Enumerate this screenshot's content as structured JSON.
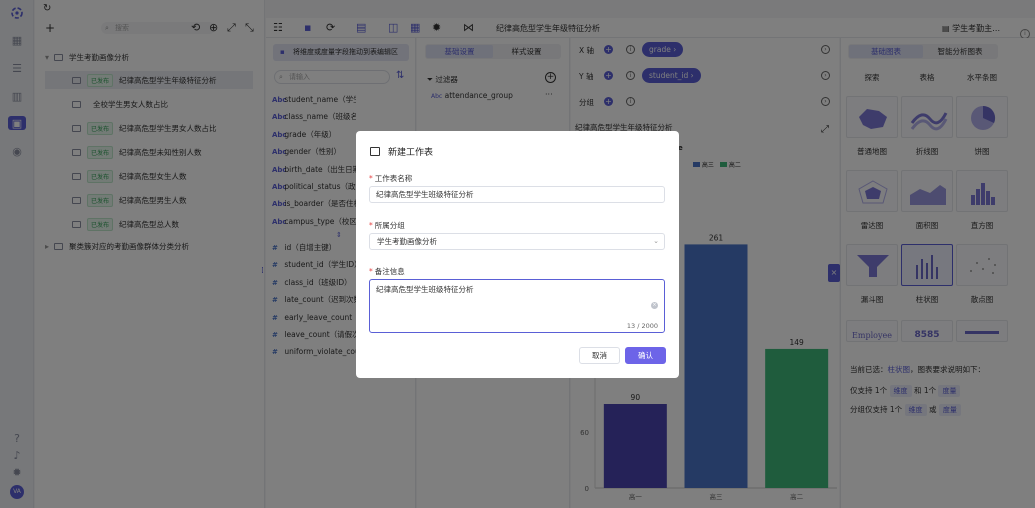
{
  "app": {
    "breadcrumb_title": "纪律高危型学生年级特征分析",
    "right_title": "学生考勤主…",
    "avatar": "VA"
  },
  "tree": {
    "search_placeholder": "搜索",
    "root": "学生考勤画像分析",
    "items": [
      {
        "badge": "已发布",
        "label": "纪律高危型学生年级特征分析",
        "selected": true
      },
      {
        "badge": "",
        "label": "全校学生男女人数占比",
        "selected": false
      },
      {
        "badge": "已发布",
        "label": "纪律高危型学生男女人数占比",
        "selected": false
      },
      {
        "badge": "已发布",
        "label": "纪律高危型未知性别人数",
        "selected": false
      },
      {
        "badge": "已发布",
        "label": "纪律高危型女生人数",
        "selected": false
      },
      {
        "badge": "已发布",
        "label": "纪律高危型男生人数",
        "selected": false
      },
      {
        "badge": "已发布",
        "label": "纪律高危型总人数",
        "selected": false
      }
    ],
    "root2": "聚类簇对应的考勤画像群体分类分析"
  },
  "fields": {
    "hint": "将维度或度量字段拖动到表编辑区",
    "search_placeholder": "请输入",
    "dimensions": [
      "student_name（学生姓名）",
      "class_name（班级名称）",
      "grade（年级）",
      "gender（性别）",
      "birth_date（出生日期）",
      "political_status（政治面貌）",
      "is_boarder（是否住校）",
      "campus_type（校区类型）"
    ],
    "measures": [
      "id（自增主键）",
      "student_id（学生ID）",
      "class_id（班级ID）",
      "late_count（迟到次数）",
      "early_leave_count",
      "leave_count（请假次数）",
      "uniform_violate_count"
    ]
  },
  "settings": {
    "tab_basic": "基础设置",
    "tab_style": "样式设置",
    "filter_label": "过滤器",
    "filter_item": "attendance_group",
    "filter_type": "Abc"
  },
  "chart": {
    "x_label": "X 轴",
    "x_pill": "grade ›",
    "y_label": "Y 轴",
    "y_pill": "student_id ›",
    "group_label": "分组",
    "title": "纪律高危型学生年级特征分析",
    "legend_partial": "e",
    "legend": [
      "高三",
      "高二"
    ]
  },
  "chart_data": {
    "type": "bar",
    "title": "纪律高危型学生年级特征分析",
    "categories": [
      "高一",
      "高三",
      "高二"
    ],
    "values": [
      90,
      261,
      149
    ],
    "colors": [
      "#4b45b0",
      "#4a74c9",
      "#3fb87a"
    ],
    "y_ticks_visible": [
      "60",
      "0"
    ],
    "ylim": [
      0,
      300
    ]
  },
  "gallery": {
    "tab_basic": "基础图表",
    "tab_smart": "智能分析图表",
    "top_labels": [
      "探索",
      "表格",
      "水平条图"
    ],
    "charts": [
      "普通地图",
      "折线图",
      "饼图",
      "雷达图",
      "面积图",
      "直方图",
      "漏斗图",
      "柱状图",
      "散点图"
    ],
    "partial_labels": [
      "Employee",
      "8585"
    ],
    "selected_text_prefix": "当前已选：",
    "selected_chart": "柱状图",
    "selected_text_suffix": "，图表要求说明如下：",
    "rule1_a": "仅支持 1个",
    "rule1_dim": "维度",
    "rule1_b": "和 1个",
    "rule1_mea": "度量",
    "rule2_a": "分组仅支持 1个",
    "rule2_dim": "维度",
    "rule2_b": "或",
    "rule2_mea": "度量"
  },
  "modal": {
    "title": "新建工作表",
    "name_label": "工作表名称",
    "name_value": "纪律高危型学生班级特征分析",
    "group_label": "所属分组",
    "group_value": "学生考勤画像分析",
    "note_label": "备注信息",
    "note_value": "纪律高危型学生班级特征分析",
    "note_count": "13 / 2000",
    "cancel": "取消",
    "confirm": "确认"
  }
}
